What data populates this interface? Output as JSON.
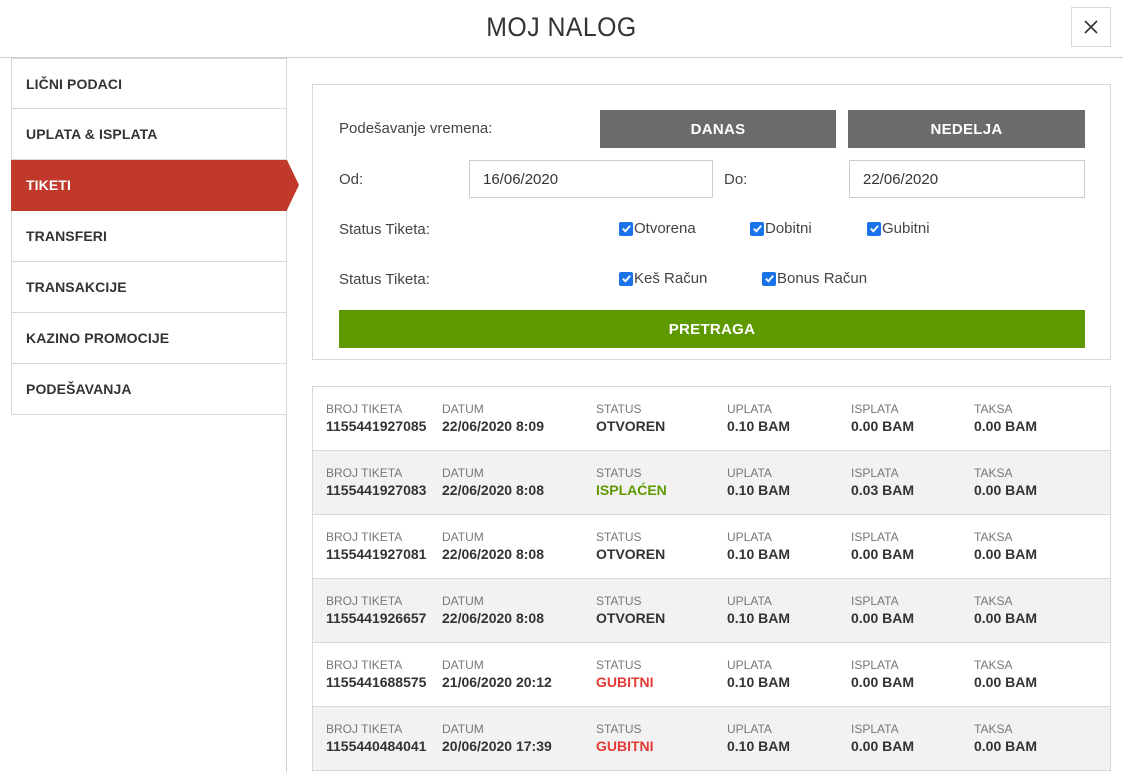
{
  "header": {
    "title": "MOJ NALOG"
  },
  "sidebar": {
    "items": [
      {
        "label": "LIČNI PODACI",
        "active": false
      },
      {
        "label": "UPLATA & ISPLATA",
        "active": false
      },
      {
        "label": "TIKETI",
        "active": true
      },
      {
        "label": "TRANSFERI",
        "active": false
      },
      {
        "label": "TRANSAKCIJE",
        "active": false
      },
      {
        "label": "KAZINO PROMOCIJE",
        "active": false
      },
      {
        "label": "PODEŠAVANJA",
        "active": false
      }
    ]
  },
  "filters": {
    "time_label": "Podešavanje vremena:",
    "today_label": "DANAS",
    "week_label": "NEDELJA",
    "from_label": "Od:",
    "from_value": "16/06/2020",
    "to_label": "Do:",
    "to_value": "22/06/2020",
    "status_label_1": "Status Tiketa:",
    "status_label_2": "Status Tiketa:",
    "checkboxes_1": [
      {
        "label": "Otvorena",
        "checked": true
      },
      {
        "label": "Dobitni",
        "checked": true
      },
      {
        "label": "Gubitni",
        "checked": true
      }
    ],
    "checkboxes_2": [
      {
        "label": "Keš Račun",
        "checked": true
      },
      {
        "label": "Bonus Račun",
        "checked": true
      }
    ],
    "search_label": "PRETRAGA"
  },
  "columns": {
    "ticket": "BROJ TIKETA",
    "date": "DATUM",
    "status": "STATUS",
    "stake": "UPLATA",
    "payout": "ISPLATA",
    "tax": "TAKSA"
  },
  "tickets": [
    {
      "ticket": "1155441927085",
      "date": "22/06/2020 8:09",
      "status": "OTVOREN",
      "status_type": "otvoren",
      "stake": "0.10 BAM",
      "payout": "0.00 BAM",
      "tax": "0.00 BAM"
    },
    {
      "ticket": "1155441927083",
      "date": "22/06/2020 8:08",
      "status": "ISPLAĆEN",
      "status_type": "isplacen",
      "stake": "0.10 BAM",
      "payout": "0.03 BAM",
      "tax": "0.00 BAM"
    },
    {
      "ticket": "1155441927081",
      "date": "22/06/2020 8:08",
      "status": "OTVOREN",
      "status_type": "otvoren",
      "stake": "0.10 BAM",
      "payout": "0.00 BAM",
      "tax": "0.00 BAM"
    },
    {
      "ticket": "1155441926657",
      "date": "22/06/2020 8:08",
      "status": "OTVOREN",
      "status_type": "otvoren",
      "stake": "0.10 BAM",
      "payout": "0.00 BAM",
      "tax": "0.00 BAM"
    },
    {
      "ticket": "1155441688575",
      "date": "21/06/2020 20:12",
      "status": "GUBITNI",
      "status_type": "gubitni",
      "stake": "0.10 BAM",
      "payout": "0.00 BAM",
      "tax": "0.00 BAM"
    },
    {
      "ticket": "1155440484041",
      "date": "20/06/2020 17:39",
      "status": "GUBITNI",
      "status_type": "gubitni",
      "stake": "0.10 BAM",
      "payout": "0.00 BAM",
      "tax": "0.00 BAM"
    }
  ],
  "colors": {
    "active_red": "#c0392b",
    "search_green": "#5f9900",
    "button_gray": "#6b6b6b",
    "status_won": "#5f9900",
    "status_lost": "#e53935",
    "checkbox_blue": "#1a73e8"
  },
  "icons": {
    "close": "close-icon",
    "checkbox": "checkmark-icon"
  }
}
